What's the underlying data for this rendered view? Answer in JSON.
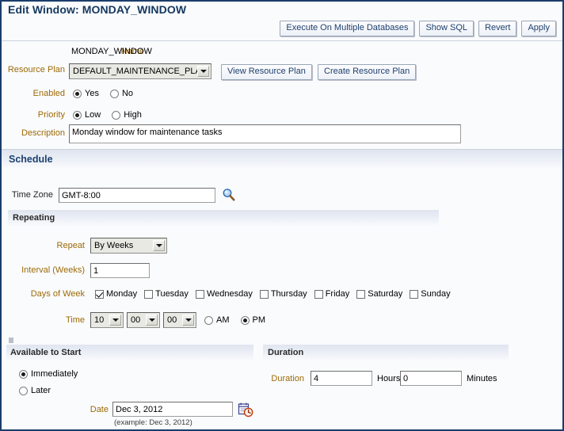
{
  "header": {
    "title": "Edit Window: MONDAY_WINDOW",
    "buttons": [
      {
        "label": "Execute On Multiple Databases",
        "name": "execute-on-multiple-databases-button"
      },
      {
        "label": "Show SQL",
        "name": "show-sql-button"
      },
      {
        "label": "Revert",
        "name": "revert-button"
      },
      {
        "label": "Apply",
        "name": "apply-button"
      }
    ]
  },
  "general": {
    "name_label": "Name",
    "name_value": "MONDAY_WINDOW",
    "resource_plan_label": "Resource Plan",
    "resource_plan_value": "DEFAULT_MAINTENANCE_PLAN",
    "view_resource_plan_button": "View Resource Plan",
    "create_resource_plan_button": "Create Resource Plan",
    "enabled_label": "Enabled",
    "enabled_yes": "Yes",
    "enabled_no": "No",
    "enabled_selected": "Yes",
    "priority_label": "Priority",
    "priority_low": "Low",
    "priority_high": "High",
    "priority_selected": "Low",
    "description_label": "Description",
    "description_value": "Monday window for maintenance tasks"
  },
  "schedule": {
    "section_title": "Schedule",
    "time_zone_label": "Time Zone",
    "time_zone_value": "GMT-8:00",
    "time_zone_search_icon": "magnifier-icon",
    "repeating": {
      "section_title": "Repeating",
      "repeat_label": "Repeat",
      "repeat_value": "By Weeks",
      "interval_label": "Interval (Weeks)",
      "interval_value": "1",
      "days_label": "Days of Week",
      "days": [
        {
          "label": "Monday",
          "checked": true
        },
        {
          "label": "Tuesday",
          "checked": false
        },
        {
          "label": "Wednesday",
          "checked": false
        },
        {
          "label": "Thursday",
          "checked": false
        },
        {
          "label": "Friday",
          "checked": false
        },
        {
          "label": "Saturday",
          "checked": false
        },
        {
          "label": "Sunday",
          "checked": false
        }
      ],
      "time_label": "Time",
      "time_hour": "10",
      "time_minute": "00",
      "time_second": "00",
      "meridiem_am": "AM",
      "meridiem_pm": "PM",
      "meridiem_selected": "PM"
    }
  },
  "available_to_start": {
    "section_title": "Available to Start",
    "immediately_label": "Immediately",
    "later_label": "Later",
    "selected": "Immediately",
    "date_label": "Date",
    "date_value": "Dec 3, 2012",
    "date_hint": "(example: Dec 3, 2012)",
    "date_picker_icon": "calendar-clock-icon"
  },
  "duration": {
    "section_title": "Duration",
    "duration_label": "Duration",
    "hours_value": "4",
    "hours_unit": "Hours",
    "minutes_value": "0",
    "minutes_unit": "Minutes"
  },
  "colors": {
    "title": "#14385f",
    "label_orange": "#9c6a05",
    "band": "#dfe4ef",
    "border": "#1a3d6b"
  }
}
